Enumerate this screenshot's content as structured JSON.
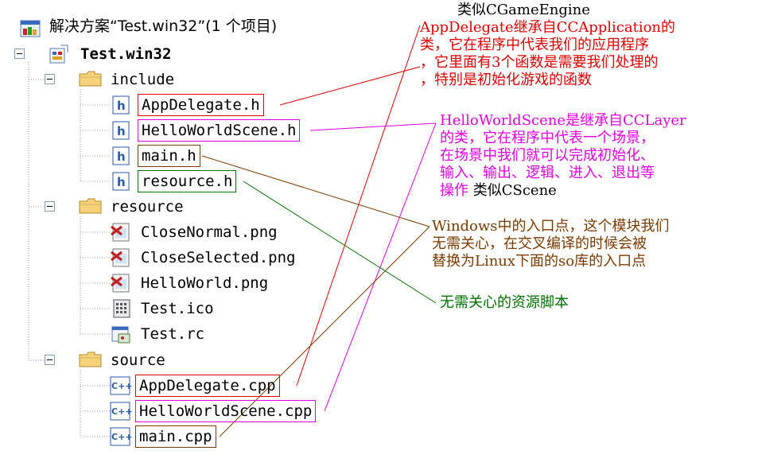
{
  "solution": {
    "title": "解决方案“Test.win32”(1 个项目)",
    "project": "Test.win32"
  },
  "tree": {
    "folders": [
      {
        "name": "include",
        "files": [
          "AppDelegate.h",
          "HelloWorldScene.h",
          "main.h",
          "resource.h"
        ]
      },
      {
        "name": "resource",
        "files": [
          "CloseNormal.png",
          "CloseSelected.png",
          "HelloWorld.png",
          "Test.ico",
          "Test.rc"
        ]
      },
      {
        "name": "source",
        "files": [
          "AppDelegate.cpp",
          "HelloWorldScene.cpp",
          "main.cpp"
        ]
      }
    ]
  },
  "annotations": {
    "engine_note": "类似CGameEngine",
    "appdelegate": [
      "AppDelegate继承自CCApplication的",
      "类，它在程序中代表我们的应用程序",
      "，它里面有3个函数是需要我们处理的",
      "，特别是初始化游戏的函数"
    ],
    "helloworld": [
      "HelloWorldScene是继承自CCLayer",
      "的类，它在程序中代表一个场景，",
      "在场景中我们就可以完成初始化、",
      "输入、输出、逻辑、进入、退出等",
      "操作"
    ],
    "helloworld_suffix": "类似CScene",
    "main": [
      "Windows中的入口点，这个模块我们",
      "无需关心，在交叉编译的时候会被",
      "替换为Linux下面的so库的入口点"
    ],
    "resource": "无需关心的资源脚本"
  },
  "colors": {
    "appdelegate": "#e00000",
    "helloworld": "#e000e0",
    "main": "#7a3b00",
    "resource": "#007000",
    "tree_line": "#808080"
  }
}
